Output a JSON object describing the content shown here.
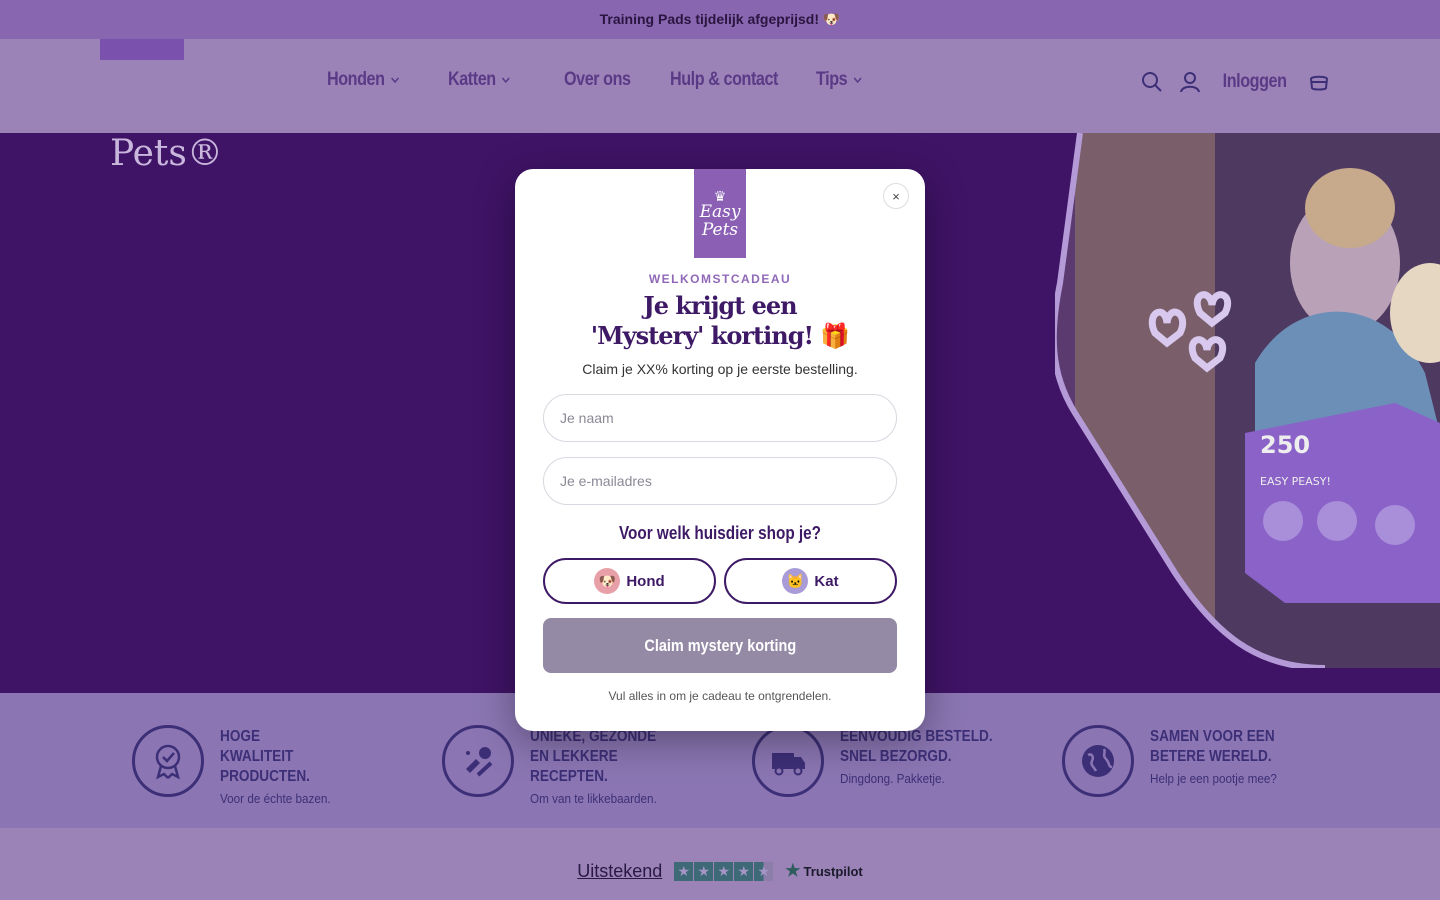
{
  "announcement": {
    "text": "Training Pads tijdelijk afgeprijsd! 🐶"
  },
  "nav": {
    "items": [
      {
        "label": "Honden",
        "dropdown": true
      },
      {
        "label": "Katten",
        "dropdown": true
      },
      {
        "label": "Over ons",
        "dropdown": false
      },
      {
        "label": "Hulp & contact",
        "dropdown": false
      },
      {
        "label": "Tips",
        "dropdown": true
      }
    ],
    "login_label": "Inloggen"
  },
  "hero": {
    "logo_text": "Pets®"
  },
  "usps": [
    {
      "title": "HOGE KWALITEIT PRODUCTEN.",
      "sub": "Voor de échte bazen.",
      "icon": "award-ribbon-icon"
    },
    {
      "title": "UNIEKE, GEZONDE EN LEKKERE RECEPTEN.",
      "sub": "Om van te likkebaarden.",
      "icon": "food-icon"
    },
    {
      "title": "EENVOUDIG BESTELD. SNEL BEZORGD.",
      "sub": "Dingdong. Pakketje.",
      "icon": "delivery-truck-icon"
    },
    {
      "title": "SAMEN VOOR EEN BETERE WERELD.",
      "sub": "Help je een pootje mee?",
      "icon": "globe-icon"
    }
  ],
  "trust": {
    "label": "Uitstekend",
    "brand": "Trustpilot",
    "rating_stars": 4.5
  },
  "modal": {
    "logo_line1": "Easy",
    "logo_line2": "Pets",
    "eyebrow": "WELKOMSTCADEAU",
    "title_line1": "Je krijgt een",
    "title_line2": "'Mystery' korting! 🎁",
    "subtitle": "Claim je XX% korting op je eerste bestelling.",
    "name_placeholder": "Je naam",
    "email_placeholder": "Je e-mailadres",
    "question": "Voor welk huisdier shop je?",
    "dog_label": "Hond",
    "cat_label": "Kat",
    "cta_label": "Claim mystery korting",
    "hint": "Vul alles in om je cadeau te ontgrendelen.",
    "close_symbol": "×"
  },
  "colors": {
    "brand_purple": "#3e1a66",
    "accent_purple": "#8a5fb4",
    "cta_disabled": "#948aa6",
    "trustpilot_star": "#3e6a78"
  }
}
